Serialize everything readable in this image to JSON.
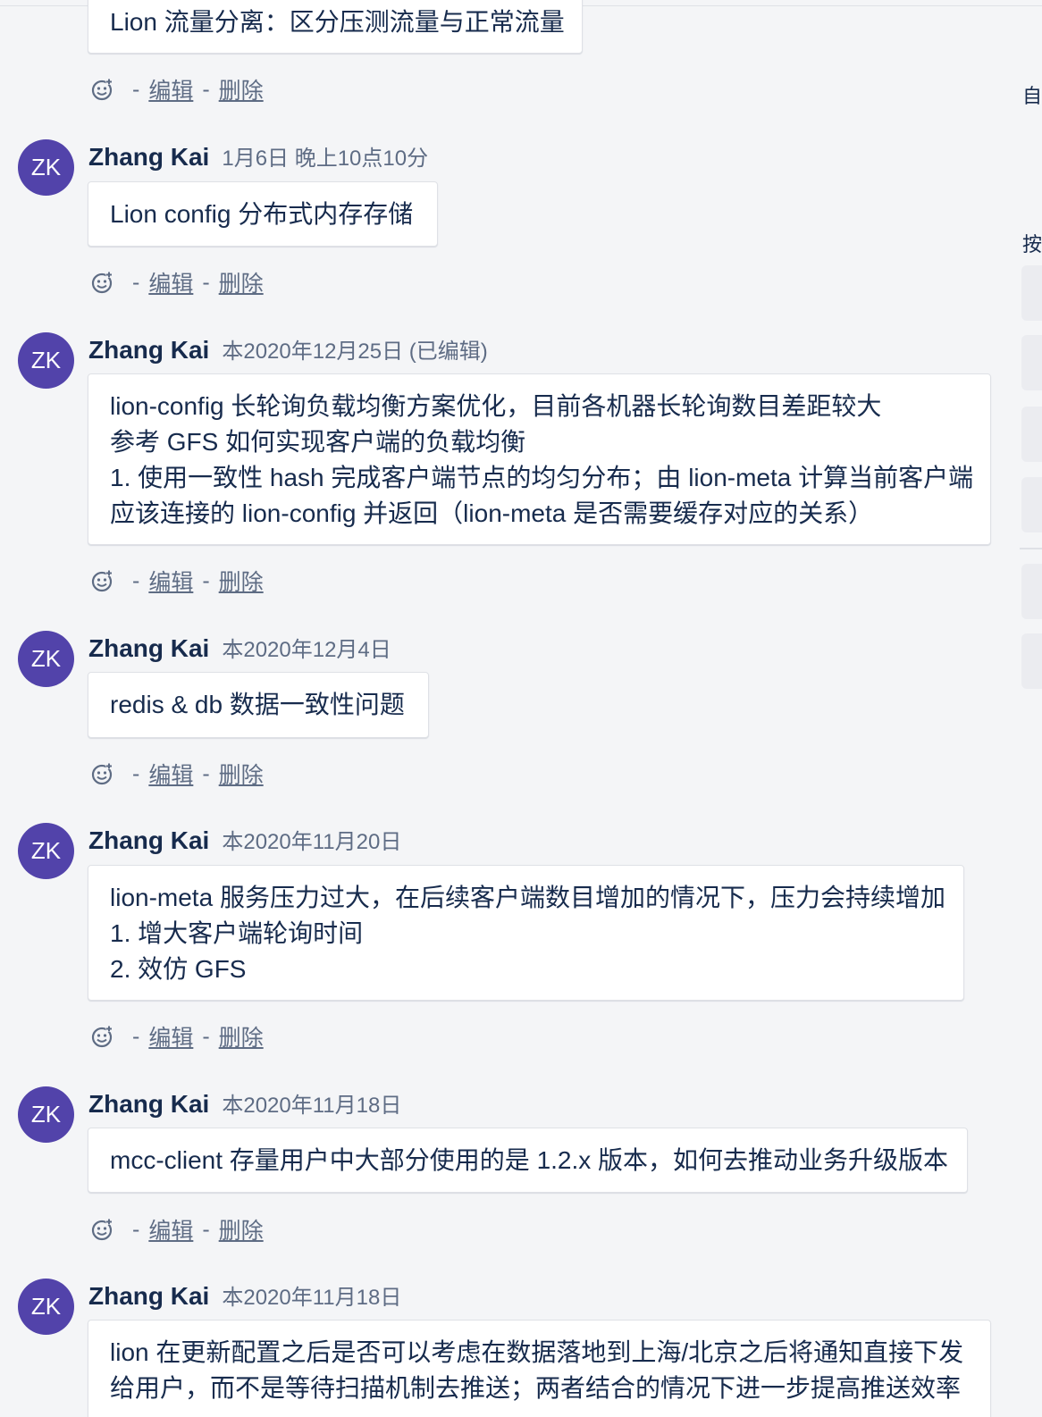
{
  "comments": [
    {
      "author": "",
      "timestamp": "",
      "lines": [
        "Lion 流量分离：区分压测流量与正常流量"
      ]
    },
    {
      "author": "Zhang Kai",
      "avatar_initials": "ZK",
      "timestamp": "1月6日 晚上10点10分",
      "lines": [
        "Lion config 分布式内存存储"
      ]
    },
    {
      "author": "Zhang Kai",
      "avatar_initials": "ZK",
      "timestamp": "本2020年12月25日 (已编辑)",
      "lines": [
        "lion-config 长轮询负载均衡方案优化，目前各机器长轮询数目差距较大",
        "参考 GFS 如何实现客户端的负载均衡",
        "1. 使用一致性 hash 完成客户端节点的均匀分布；由 lion-meta 计算当前客户端",
        "应该连接的 lion-config 并返回（lion-meta 是否需要缓存对应的关系）"
      ]
    },
    {
      "author": "Zhang Kai",
      "avatar_initials": "ZK",
      "timestamp": "本2020年12月4日",
      "lines": [
        "redis & db 数据一致性问题"
      ]
    },
    {
      "author": "Zhang Kai",
      "avatar_initials": "ZK",
      "timestamp": "本2020年11月20日",
      "lines": [
        "lion-meta 服务压力过大，在后续客户端数目增加的情况下，压力会持续增加",
        "1. 增大客户端轮询时间",
        "2. 效仿 GFS"
      ]
    },
    {
      "author": "Zhang Kai",
      "avatar_initials": "ZK",
      "timestamp": "本2020年11月18日",
      "lines": [
        "mcc-client 存量用户中大部分使用的是 1.2.x 版本，如何去推动业务升级版本"
      ]
    },
    {
      "author": "Zhang Kai",
      "avatar_initials": "ZK",
      "timestamp": "本2020年11月18日",
      "lines": [
        "lion 在更新配置之后是否可以考虑在数据落地到上海/北京之后将通知直接下发",
        "给用户，而不是等待扫描机制去推送；两者结合的情况下进一步提高推送效率"
      ]
    }
  ],
  "actions": {
    "reaction_icon": "add-reaction-icon",
    "separator": "-",
    "edit_label": "编辑",
    "delete_label": "删除"
  },
  "right_panel": {
    "glyph_1": "自",
    "glyph_2": "按"
  },
  "colors": {
    "avatar_bg": "#5243aa",
    "page_bg": "#f4f5f7",
    "text": "#172b4d",
    "muted": "#5e6c84"
  }
}
